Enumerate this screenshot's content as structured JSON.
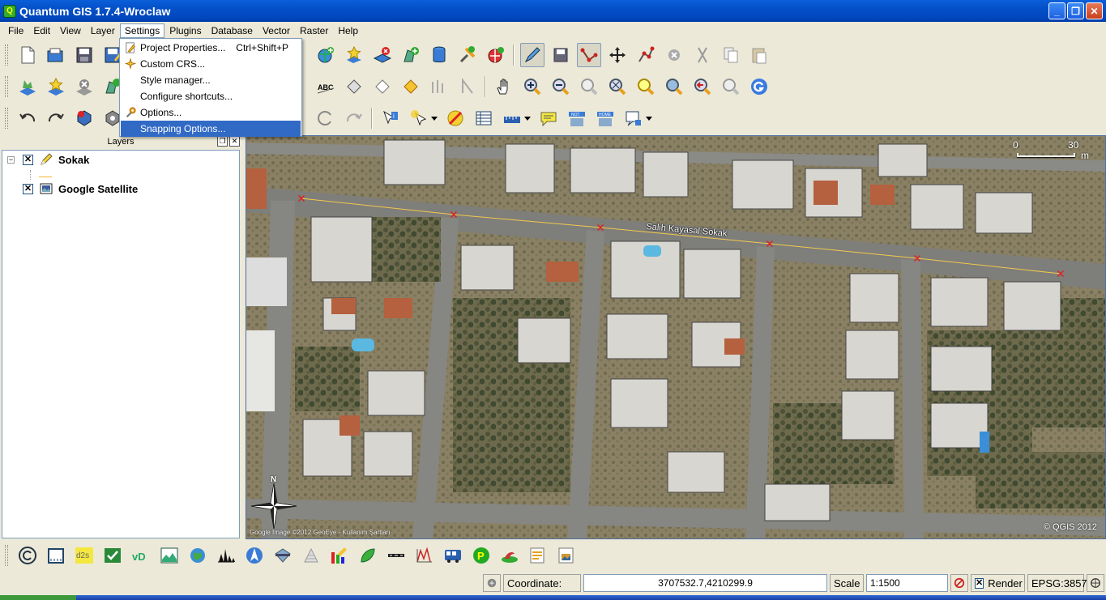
{
  "window": {
    "title": "Quantum GIS 1.7.4-Wroclaw",
    "app_icon": "qgis-icon"
  },
  "menubar": {
    "items": [
      "File",
      "Edit",
      "View",
      "Layer",
      "Settings",
      "Plugins",
      "Database",
      "Vector",
      "Raster",
      "Help"
    ],
    "open": "Settings"
  },
  "settings_menu": {
    "items": [
      {
        "label": "Project Properties...",
        "shortcut": "Ctrl+Shift+P",
        "icon": "project-properties-icon"
      },
      {
        "label": "Custom CRS...",
        "shortcut": "",
        "icon": "custom-crs-icon"
      },
      {
        "label": "Style manager...",
        "shortcut": "",
        "icon": ""
      },
      {
        "label": "Configure shortcuts...",
        "shortcut": "",
        "icon": ""
      },
      {
        "label": "Options...",
        "shortcut": "",
        "icon": "options-wrench-icon"
      },
      {
        "label": "Snapping Options...",
        "shortcut": "",
        "icon": "",
        "highlighted": true
      }
    ]
  },
  "layers_panel": {
    "title": "Layers",
    "layers": [
      {
        "name": "Sokak",
        "checked": "✕",
        "icon": "pencil-edit-icon",
        "expanded": "−"
      },
      {
        "name": "Google Satellite",
        "checked": "✕",
        "icon": "raster-icon"
      }
    ]
  },
  "map": {
    "road_label": "Salih Kayasal Sokak",
    "scale_left": "0",
    "scale_right": "30",
    "scale_unit": "m",
    "copyright": "© QGIS 2012",
    "google_copyright": "Google Image ©2012 GeoEye - Kullanım Şartları",
    "north_letter": "N",
    "line_color": "#f2c94c",
    "vertex_color": "#e02020"
  },
  "statusbar": {
    "coordinate_label": "Coordinate:",
    "coordinate_value": "3707532.7,4210299.9",
    "scale_label": "Scale",
    "scale_value": "1:1500",
    "render_label": "Render",
    "render_checked": "✕",
    "crs": "EPSG:3857"
  }
}
